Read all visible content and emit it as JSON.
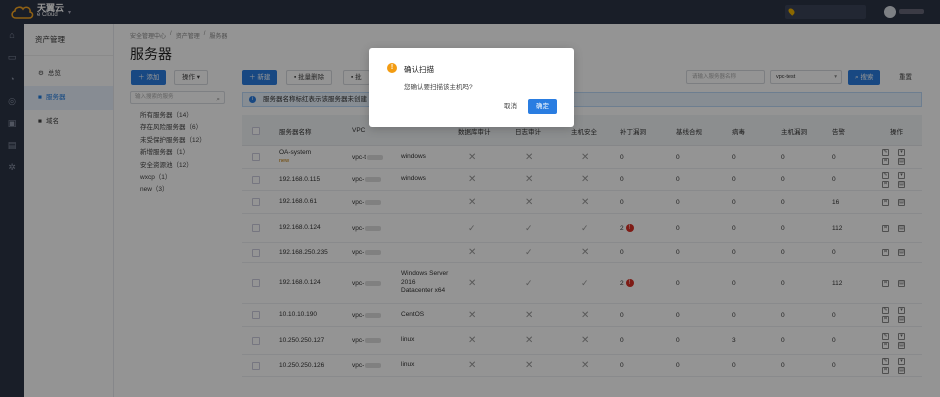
{
  "header": {
    "brand_cn": "天翼云",
    "brand_en": "e Cloud"
  },
  "sidebar": {
    "title": "资产管理",
    "items": [
      {
        "label": "总览",
        "icon": "gear-icon"
      },
      {
        "label": "服务器",
        "icon": "server-icon"
      },
      {
        "label": "域名",
        "icon": "domain-icon"
      }
    ]
  },
  "breadcrumb": [
    "安全管理中心",
    "资产管理",
    "服务器"
  ],
  "page_title": "服务器",
  "left_toolbar": {
    "add": "添加",
    "ops": "操作"
  },
  "group_search_placeholder": "输入搜索的服务",
  "groups": [
    "所有服务器（14）",
    "存在风险服务器（6）",
    "未受保护服务器（12）",
    "新增服务器（1）",
    "安全资源池（12）",
    "wxcp（1）",
    "new（3）"
  ],
  "toolbar": {
    "new": "新建",
    "batch_delete": "批量删除",
    "third": "批"
  },
  "filters": {
    "name_placeholder": "请输入服务器名称",
    "vpc_value": "vpc-test",
    "search": "搜索",
    "reset": "重置"
  },
  "notice": "服务器名称标红表示该服务器未创建",
  "table": {
    "headers": [
      "服务器名称",
      "VPC",
      "",
      "数据库审计",
      "日志审计",
      "主机安全",
      "补丁漏洞",
      "基线合规",
      "病毒",
      "主机漏洞",
      "告警",
      "操作"
    ],
    "rows": [
      {
        "name": "OA-system",
        "sub": "new",
        "vpc": "vpc-t",
        "os": "windows",
        "c1": "x",
        "c2": "x",
        "c3": "x",
        "patch": "0",
        "patch_alert": false,
        "base": "0",
        "virus": "0",
        "vuln": "0",
        "alarm": "0",
        "acts": 4
      },
      {
        "name": "192.168.0.115",
        "sub": "",
        "vpc": "vpc-",
        "os": "windows",
        "c1": "x",
        "c2": "x",
        "c3": "x",
        "patch": "0",
        "patch_alert": false,
        "base": "0",
        "virus": "0",
        "vuln": "0",
        "alarm": "0",
        "acts": 4
      },
      {
        "name": "192.168.0.61",
        "sub": "",
        "vpc": "vpc-",
        "os": "",
        "c1": "x",
        "c2": "x",
        "c3": "x",
        "patch": "0",
        "patch_alert": false,
        "base": "0",
        "virus": "0",
        "vuln": "0",
        "alarm": "16",
        "acts": 2
      },
      {
        "name": "192.168.0.124",
        "sub": "",
        "vpc": "vpc-",
        "os": "",
        "c1": "v",
        "c2": "v",
        "c3": "v",
        "patch": "2",
        "patch_alert": true,
        "base": "0",
        "virus": "0",
        "vuln": "0",
        "alarm": "112",
        "acts": 2
      },
      {
        "name": "192.168.250.235",
        "sub": "",
        "vpc": "vpc-",
        "os": "",
        "c1": "x",
        "c2": "v",
        "c3": "x",
        "patch": "0",
        "patch_alert": false,
        "base": "0",
        "virus": "0",
        "vuln": "0",
        "alarm": "0",
        "acts": 2
      },
      {
        "name": "192.168.0.124",
        "sub": "",
        "vpc": "vpc-",
        "os": "Windows Server 2016 Datacenter x64",
        "c1": "x",
        "c2": "v",
        "c3": "v",
        "patch": "2",
        "patch_alert": true,
        "base": "0",
        "virus": "0",
        "vuln": "0",
        "alarm": "112",
        "acts": 2
      },
      {
        "name": "10.10.10.190",
        "sub": "",
        "vpc": "vpc-",
        "os": "CentOS",
        "c1": "x",
        "c2": "x",
        "c3": "x",
        "patch": "0",
        "patch_alert": false,
        "base": "0",
        "virus": "0",
        "vuln": "0",
        "alarm": "0",
        "acts": 4
      },
      {
        "name": "10.250.250.127",
        "sub": "",
        "vpc": "vpc-",
        "os": "linux",
        "c1": "x",
        "c2": "x",
        "c3": "x",
        "patch": "0",
        "patch_alert": false,
        "base": "0",
        "virus": "3",
        "vuln": "0",
        "alarm": "0",
        "acts": 4
      },
      {
        "name": "10.250.250.126",
        "sub": "",
        "vpc": "vpc-",
        "os": "linux",
        "c1": "x",
        "c2": "x",
        "c3": "x",
        "patch": "0",
        "patch_alert": false,
        "base": "0",
        "virus": "0",
        "vuln": "0",
        "alarm": "0",
        "acts": 4
      }
    ]
  },
  "dialog": {
    "title": "确认扫描",
    "message": "您确认要扫描该主机吗?",
    "cancel": "取消",
    "ok": "确定"
  },
  "colors": {
    "accent": "#2a7de1",
    "topbar": "#2c3446",
    "warning": "#f39c12",
    "danger": "#d93025"
  }
}
